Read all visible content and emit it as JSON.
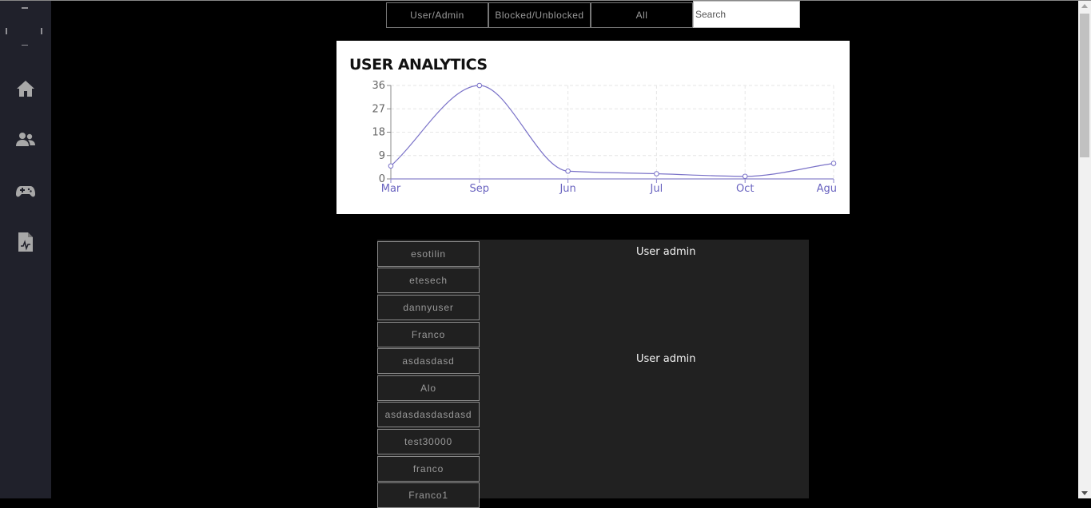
{
  "filters": {
    "user_admin": "User/Admin",
    "blocked_unblocked": "Blocked/Unblocked",
    "all": "All",
    "search_placeholder": "Search",
    "search_value": ""
  },
  "sidebar": {
    "items": [
      {
        "icon": "home-icon"
      },
      {
        "icon": "users-icon"
      },
      {
        "icon": "gamepad-icon"
      },
      {
        "icon": "report-icon"
      }
    ]
  },
  "chart_data": {
    "type": "line",
    "title": "USER ANALYTICS",
    "categories": [
      "Mar",
      "Sep",
      "Jun",
      "Jul",
      "Oct",
      "Agu"
    ],
    "values": [
      5,
      36,
      3,
      2,
      1,
      6
    ],
    "yticks": [
      0,
      9,
      18,
      27,
      36
    ],
    "ylim": [
      0,
      36
    ],
    "grid": true,
    "line_color": "#7a72c8"
  },
  "users": [
    "esotilin",
    "etesech",
    "dannyuser",
    "Franco",
    "asdasdasd",
    "Alo",
    "asdasdasdasdasd",
    "test30000",
    "franco",
    "Franco1"
  ],
  "roles": [
    {
      "label": "User admin"
    },
    {
      "label": "User admin"
    }
  ]
}
